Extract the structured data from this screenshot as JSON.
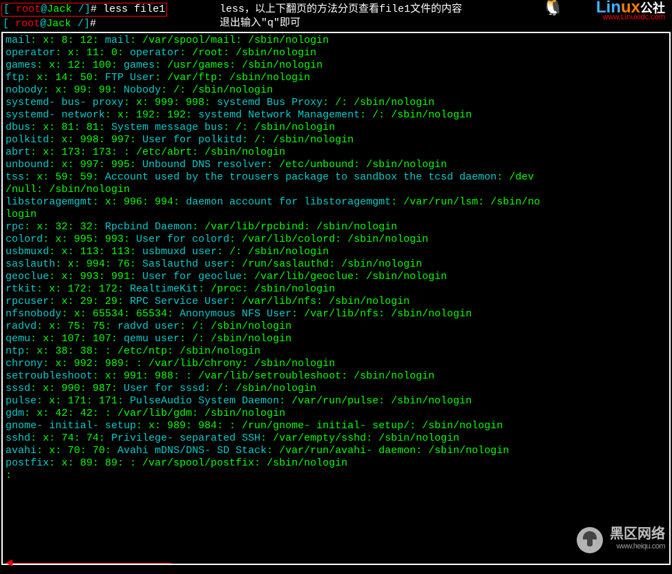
{
  "header": {
    "prompt1_bracket_open": "[ ",
    "prompt1_user": "root",
    "prompt1_at": "@",
    "prompt1_host": "Jack ",
    "prompt1_path": "/",
    "prompt1_bracket_close": "]",
    "prompt1_hash": "# ",
    "prompt1_cmd": "less file1",
    "prompt2_bracket_open": "[ ",
    "prompt2_user": "root",
    "prompt2_at": "@",
    "prompt2_host": "Jack ",
    "prompt2_path": "/",
    "prompt2_bracket_close": "]",
    "prompt2_hash": "# ",
    "annotation_line1": "less，以上下翻页的方法分页查看file1文件的内容",
    "annotation_line2": "退出输入\"q\"即可",
    "logo_lin": "Lin",
    "logo_ux": "ux",
    "logo_cn": "公社",
    "logo_url": "www.Linuxidc.com",
    "penguin": "🐧"
  },
  "watermark": {
    "line1": "黑区网络",
    "line2": "www.heiqu.com"
  },
  "lines": [
    [
      [
        "mail",
        "teal"
      ],
      [
        ": x: 8: 12: ",
        ""
      ],
      [
        "mail",
        "teal"
      ],
      [
        ": /var/spool/mail: /sbin/nologin",
        ""
      ]
    ],
    [
      [
        "operator",
        "teal"
      ],
      [
        ": x: 11: 0: ",
        ""
      ],
      [
        "operator",
        "teal"
      ],
      [
        ": /root: /sbin/nologin",
        ""
      ]
    ],
    [
      [
        "games",
        "teal"
      ],
      [
        ": x: 12: 100: ",
        ""
      ],
      [
        "games",
        "teal"
      ],
      [
        ": /usr/games: /sbin/nologin",
        ""
      ]
    ],
    [
      [
        "ftp",
        "teal"
      ],
      [
        ": x: 14: 50: ",
        ""
      ],
      [
        "FTP User",
        "teal"
      ],
      [
        ": /var/ftp: /sbin/nologin",
        ""
      ]
    ],
    [
      [
        "nobody",
        "teal"
      ],
      [
        ": x: 99: 99: ",
        ""
      ],
      [
        "Nobody",
        "teal"
      ],
      [
        ": /: /sbin/nologin",
        ""
      ]
    ],
    [
      [
        "systemd- bus- proxy",
        "teal"
      ],
      [
        ": x: 999: 998: ",
        ""
      ],
      [
        "systemd Bus Proxy",
        "teal"
      ],
      [
        ": /: /sbin/nologin",
        ""
      ]
    ],
    [
      [
        "systemd- network",
        "teal"
      ],
      [
        ": x: 192: 192: ",
        ""
      ],
      [
        "systemd Network Management",
        "teal"
      ],
      [
        ": /: /sbin/nologin",
        ""
      ]
    ],
    [
      [
        "dbus",
        "teal"
      ],
      [
        ": x: 81: 81: ",
        ""
      ],
      [
        "System message bus",
        "teal"
      ],
      [
        ": /: /sbin/nologin",
        ""
      ]
    ],
    [
      [
        "polkitd",
        "teal"
      ],
      [
        ": x: 998: 997: ",
        ""
      ],
      [
        "User for polkitd",
        "teal"
      ],
      [
        ": /: /sbin/nologin",
        ""
      ]
    ],
    [
      [
        "abrt",
        "teal"
      ],
      [
        ": x: 173: 173: : /etc/abrt: /sbin/nologin",
        ""
      ]
    ],
    [
      [
        "unbound",
        "teal"
      ],
      [
        ": x: 997: 995: ",
        ""
      ],
      [
        "Unbound DNS resolver",
        "teal"
      ],
      [
        ": /etc/unbound: /sbin/nologin",
        ""
      ]
    ],
    [
      [
        "tss",
        "teal"
      ],
      [
        ": x: 59: 59: ",
        ""
      ],
      [
        "Account used by the trousers package to sandbox the tcsd daemon",
        "teal"
      ],
      [
        ": /dev",
        ""
      ]
    ],
    [
      [
        "/null: /sbin/nologin",
        ""
      ]
    ],
    [
      [
        "libstoragemgmt",
        "teal"
      ],
      [
        ": x: 996: 994: ",
        ""
      ],
      [
        "daemon account for libstoragemgmt",
        "teal"
      ],
      [
        ": /var/run/lsm: /sbin/no",
        ""
      ]
    ],
    [
      [
        "login",
        ""
      ]
    ],
    [
      [
        "rpc",
        "teal"
      ],
      [
        ": x: 32: 32: ",
        ""
      ],
      [
        "Rpcbind Daemon",
        "teal"
      ],
      [
        ": /var/lib/rpcbind: /sbin/nologin",
        ""
      ]
    ],
    [
      [
        "colord",
        "teal"
      ],
      [
        ": x: 995: 993: ",
        ""
      ],
      [
        "User for colord",
        "teal"
      ],
      [
        ": /var/lib/colord: /sbin/nologin",
        ""
      ]
    ],
    [
      [
        "usbmuxd",
        "teal"
      ],
      [
        ": x: 113: 113: ",
        ""
      ],
      [
        "usbmuxd user",
        "teal"
      ],
      [
        ": /: /sbin/nologin",
        ""
      ]
    ],
    [
      [
        "saslauth",
        "teal"
      ],
      [
        ": x: 994: 76: ",
        ""
      ],
      [
        "Saslauthd user",
        "teal"
      ],
      [
        ": /run/saslauthd: /sbin/nologin",
        ""
      ]
    ],
    [
      [
        "geoclue",
        "teal"
      ],
      [
        ": x: 993: 991: ",
        ""
      ],
      [
        "User for geoclue",
        "teal"
      ],
      [
        ": /var/lib/geoclue: /sbin/nologin",
        ""
      ]
    ],
    [
      [
        "rtkit",
        "teal"
      ],
      [
        ": x: 172: 172: ",
        ""
      ],
      [
        "RealtimeKit",
        "teal"
      ],
      [
        ": /proc: /sbin/nologin",
        ""
      ]
    ],
    [
      [
        "rpcuser",
        "teal"
      ],
      [
        ": x: 29: 29: ",
        ""
      ],
      [
        "RPC Service User",
        "teal"
      ],
      [
        ": /var/lib/nfs: /sbin/nologin",
        ""
      ]
    ],
    [
      [
        "nfsnobody",
        "teal"
      ],
      [
        ": x: 65534: 65534: ",
        ""
      ],
      [
        "Anonymous NFS User",
        "teal"
      ],
      [
        ": /var/lib/nfs: /sbin/nologin",
        ""
      ]
    ],
    [
      [
        "radvd",
        "teal"
      ],
      [
        ": x: 75: 75: ",
        ""
      ],
      [
        "radvd user",
        "teal"
      ],
      [
        ": /: /sbin/nologin",
        ""
      ]
    ],
    [
      [
        "qemu",
        "teal"
      ],
      [
        ": x: 107: 107: ",
        ""
      ],
      [
        "qemu user",
        "teal"
      ],
      [
        ": /: /sbin/nologin",
        ""
      ]
    ],
    [
      [
        "ntp",
        "teal"
      ],
      [
        ": x: 38: 38: : /etc/ntp: /sbin/nologin",
        ""
      ]
    ],
    [
      [
        "chrony",
        "teal"
      ],
      [
        ": x: 992: 989: : /var/lib/chrony: /sbin/nologin",
        ""
      ]
    ],
    [
      [
        "setroubleshoot",
        "teal"
      ],
      [
        ": x: 991: 988: : /var/lib/setroubleshoot: /sbin/nologin",
        ""
      ]
    ],
    [
      [
        "sssd",
        "teal"
      ],
      [
        ": x: 990: 987: ",
        ""
      ],
      [
        "User for sssd",
        "teal"
      ],
      [
        ": /: /sbin/nologin",
        ""
      ]
    ],
    [
      [
        "pulse",
        "teal"
      ],
      [
        ": x: 171: 171: ",
        ""
      ],
      [
        "PulseAudio System Daemon",
        "teal"
      ],
      [
        ": /var/run/pulse: /sbin/nologin",
        ""
      ]
    ],
    [
      [
        "gdm",
        "teal"
      ],
      [
        ": x: 42: 42: : /var/lib/gdm: /sbin/nologin",
        ""
      ]
    ],
    [
      [
        "gnome- initial- setup",
        "teal"
      ],
      [
        ": x: 989: 984: : /run/gnome- initial- setup/: /sbin/nologin",
        ""
      ]
    ],
    [
      [
        "sshd",
        "teal"
      ],
      [
        ": x: 74: 74: ",
        ""
      ],
      [
        "Privilege- separated SSH",
        "teal"
      ],
      [
        ": /var/empty/sshd: /sbin/nologin",
        ""
      ]
    ],
    [
      [
        "avahi",
        "teal"
      ],
      [
        ": x: 70: 70: ",
        ""
      ],
      [
        "Avahi mDNS/DNS- SD Stack",
        "teal"
      ],
      [
        ": /var/run/avahi- daemon: /sbin/nologin",
        ""
      ]
    ],
    [
      [
        "postfix",
        "teal"
      ],
      [
        ": x: 89: 89: : /var/spool/postfix: /sbin/nologin",
        ""
      ]
    ],
    [
      [
        ": ",
        ""
      ]
    ]
  ]
}
